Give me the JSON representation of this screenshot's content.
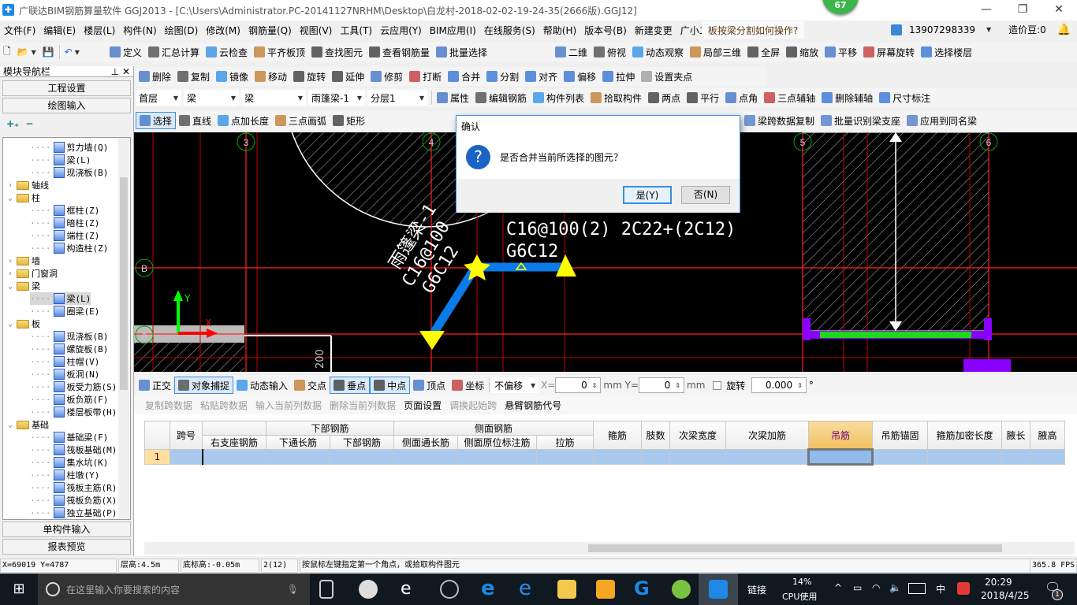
{
  "window": {
    "title": "广联达BIM钢筋算量软件 GGJ2013 - [C:\\Users\\Administrator.PC-20141127NRHM\\Desktop\\白龙村-2018-02-02-19-24-35(2666版).GGJ12]",
    "badge": "67"
  },
  "menu": [
    "文件(F)",
    "编辑(E)",
    "楼层(L)",
    "构件(N)",
    "绘图(D)",
    "修改(M)",
    "钢筋量(Q)",
    "视图(V)",
    "工具(T)",
    "云应用(Y)",
    "BIM应用(I)",
    "在线服务(S)",
    "帮助(H)",
    "版本号(B)",
    "新建变更",
    "广小二"
  ],
  "help_question": "板按梁分割如何操作?",
  "account": {
    "phone": "13907298339",
    "beans": "造价豆:0"
  },
  "toolbar1": [
    "定义",
    "汇总计算",
    "云检查",
    "平齐板顶",
    "查找图元",
    "查看钢筋量",
    "批量选择"
  ],
  "toolbar1_right": [
    "二维",
    "俯视",
    "动态观察",
    "局部三维",
    "全屏",
    "缩放",
    "平移",
    "屏幕旋转",
    "选择楼层"
  ],
  "toolbar2": [
    "删除",
    "复制",
    "镜像",
    "移动",
    "旋转",
    "延伸",
    "修剪",
    "打断",
    "合并",
    "分割",
    "对齐",
    "偏移",
    "拉伸",
    "设置夹点"
  ],
  "selectors": [
    "首层",
    "梁",
    "梁",
    "雨篷梁-1",
    "分层1"
  ],
  "toolbar3": [
    "属性",
    "编辑钢筋",
    "构件列表",
    "拾取构件",
    "两点",
    "平行",
    "点角",
    "三点辅轴",
    "删除辅轴",
    "尺寸标注"
  ],
  "toolbar4": [
    "选择",
    "直线",
    "点加长度",
    "三点画弧",
    "矩形",
    "梁跨数据复制",
    "批量识别梁支座",
    "应用到同名梁"
  ],
  "nav": {
    "title": "模块导航栏",
    "project_settings": "工程设置",
    "drawing_input": "绘图输入",
    "single_input": "单构件输入",
    "report_preview": "报表预览",
    "tree": [
      {
        "label": "剪力墙(Q)",
        "level": 2
      },
      {
        "label": "梁(L)",
        "level": 2
      },
      {
        "label": "现浇板(B)",
        "level": 2
      },
      {
        "label": "轴线",
        "level": 1,
        "state": "collapsed"
      },
      {
        "label": "柱",
        "level": 1,
        "state": "expanded"
      },
      {
        "label": "框柱(Z)",
        "level": 2
      },
      {
        "label": "暗柱(Z)",
        "level": 2
      },
      {
        "label": "端柱(Z)",
        "level": 2
      },
      {
        "label": "构造柱(Z)",
        "level": 2
      },
      {
        "label": "墙",
        "level": 1,
        "state": "collapsed"
      },
      {
        "label": "门窗洞",
        "level": 1,
        "state": "collapsed"
      },
      {
        "label": "梁",
        "level": 1,
        "state": "expanded"
      },
      {
        "label": "梁(L)",
        "level": 2,
        "selected": true
      },
      {
        "label": "圈梁(E)",
        "level": 2
      },
      {
        "label": "板",
        "level": 1,
        "state": "expanded"
      },
      {
        "label": "现浇板(B)",
        "level": 2
      },
      {
        "label": "螺旋板(B)",
        "level": 2
      },
      {
        "label": "柱帽(V)",
        "level": 2
      },
      {
        "label": "板洞(N)",
        "level": 2
      },
      {
        "label": "板受力筋(S)",
        "level": 2
      },
      {
        "label": "板负筋(F)",
        "level": 2
      },
      {
        "label": "楼层板带(H)",
        "level": 2
      },
      {
        "label": "基础",
        "level": 1,
        "state": "expanded"
      },
      {
        "label": "基础梁(F)",
        "level": 2
      },
      {
        "label": "筏板基础(M)",
        "level": 2
      },
      {
        "label": "集水坑(K)",
        "level": 2
      },
      {
        "label": "柱墩(Y)",
        "level": 2
      },
      {
        "label": "筏板主筋(R)",
        "level": 2
      },
      {
        "label": "筏板负筋(X)",
        "level": 2
      },
      {
        "label": "独立基础(P)",
        "level": 2
      }
    ]
  },
  "canvas": {
    "axes": [
      "3",
      "4",
      "5",
      "6",
      "B",
      "A"
    ],
    "label1": "C16@100(2)  2C22+(2C12)",
    "label2": "G6C12",
    "diag1": "雨篷梁-1",
    "diag2": "C16@100",
    "diag3": "G6C12",
    "dim": "200",
    "y": "Y",
    "x": "X"
  },
  "dialog": {
    "title": "确认",
    "message": "是否合并当前所选择的图元？",
    "yes": "是(Y)",
    "no": "否(N)"
  },
  "snap": {
    "items": [
      "正交",
      "对象捕捉",
      "动态输入",
      "交点",
      "垂点",
      "中点",
      "顶点",
      "坐标"
    ],
    "offset": "不偏移",
    "x_label": "X=",
    "x": "0",
    "y_label": "Y=",
    "y": "0",
    "unit": "mm",
    "rotate": "旋转",
    "rotate_value": "0.000",
    "deg": "°"
  },
  "grid_toolbar": [
    "复制跨数据",
    "粘贴跨数据",
    "输入当前列数据",
    "删除当前列数据",
    "页面设置",
    "调换起始跨",
    "悬臂钢筋代号"
  ],
  "table": {
    "groups": {
      "bottom": "下部钢筋",
      "side": "侧面钢筋"
    },
    "columns": [
      "跨号",
      "右支座钢筋",
      "下通长筋",
      "下部钢筋",
      "侧面通长筋",
      "侧面原位标注筋",
      "拉筋",
      "箍筋",
      "肢数",
      "次梁宽度",
      "次梁加筋",
      "吊筋",
      "吊筋锚固",
      "箍筋加密长度",
      "腋长",
      "腋高"
    ],
    "rows": [
      {
        "index": "1"
      }
    ],
    "active_column": "吊筋"
  },
  "status": {
    "coords": "X=69019 Y=4787",
    "floor_height": "层高:4.5m",
    "base_elev": "底标高:-0.05m",
    "count": "2(12)",
    "hint": "按鼠标左键指定第一个角点，或拾取构件图元",
    "fps": "365.8 FPS"
  },
  "taskbar": {
    "search": "在这里输入你要搜索的内容",
    "link": "链接",
    "cpu": "14%",
    "cpu_label": "CPU使用",
    "ime": "中",
    "time": "20:29",
    "date": "2018/4/25",
    "notif": "1"
  },
  "colors": {
    "canvas": "#000000",
    "axis": "#ff0000",
    "beam": "#0a7be8",
    "grip": "#ffff00",
    "selected_row": "#a9c9ee",
    "active_header": "#f3c96a"
  }
}
